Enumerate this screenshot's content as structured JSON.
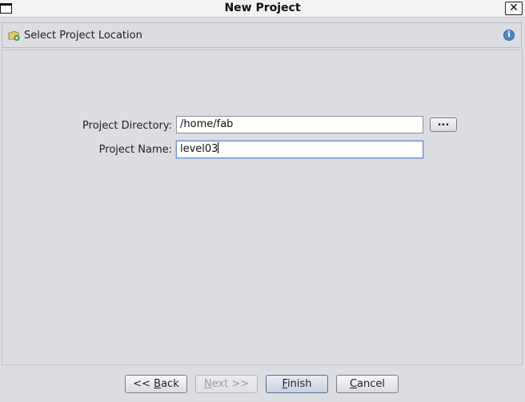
{
  "window": {
    "title": "New Project",
    "close_label": "✕"
  },
  "header": {
    "title": "Select Project Location",
    "info_glyph": "i"
  },
  "form": {
    "directory": {
      "label": "Project Directory:",
      "value": "/home/fab",
      "browse_label": "..."
    },
    "name": {
      "label": "Project Name:",
      "value": "level03"
    }
  },
  "footer": {
    "back": {
      "label": "<< Back",
      "mnemonic_pre": "<< ",
      "mnemonic": "B",
      "mnemonic_post": "ack"
    },
    "next": {
      "label": "Next >>",
      "mnemonic_pre": "",
      "mnemonic": "N",
      "mnemonic_post": "ext >>",
      "enabled": false
    },
    "finish": {
      "label": "Finish",
      "mnemonic_pre": "",
      "mnemonic": "F",
      "mnemonic_post": "inish"
    },
    "cancel": {
      "label": "Cancel",
      "mnemonic_pre": "",
      "mnemonic": "C",
      "mnemonic_post": "ancel"
    }
  },
  "colors": {
    "background": "#dcdde2",
    "info_icon": "#4a88c9",
    "focus_ring": "#a9c3e6"
  }
}
